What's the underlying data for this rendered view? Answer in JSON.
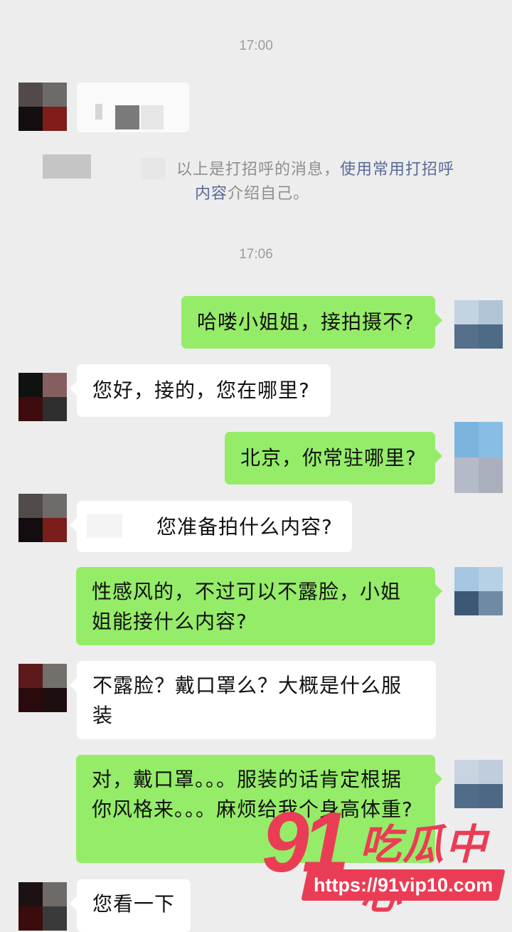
{
  "timestamps": [
    "17:00",
    "17:06"
  ],
  "system_notice": {
    "text_before": "以上是打招呼的消息，",
    "link_text": "使用常用打招呼",
    "link_text_2": "内容",
    "text_after": "介绍自己。"
  },
  "messages": [
    {
      "side": "out",
      "text": "哈喽小姐姐，接拍摄不?"
    },
    {
      "side": "in",
      "text": "您好，接的，您在哪里?"
    },
    {
      "side": "out",
      "text": "北京，你常驻哪里?"
    },
    {
      "side": "in",
      "text": "您准备拍什么内容?"
    },
    {
      "side": "out",
      "text": "性感风的，不过可以不露脸，小姐姐能接什么内容?"
    },
    {
      "side": "in",
      "text": "不露脸？戴口罩么？大概是什么服装"
    },
    {
      "side": "out",
      "text": "对，戴口罩。。。服装的话肯定根据你风格来。。。麻烦给我个身高体重?"
    },
    {
      "side": "in",
      "text": "您看一下"
    }
  ],
  "watermark": {
    "number": "91",
    "title": "吃瓜中心",
    "url": "https://91vip10.com"
  },
  "colors": {
    "background": "#ededed",
    "incoming_bubble": "#ffffff",
    "outgoing_bubble": "#95ec69",
    "link": "#576b95",
    "watermark": "#ea3d55"
  }
}
